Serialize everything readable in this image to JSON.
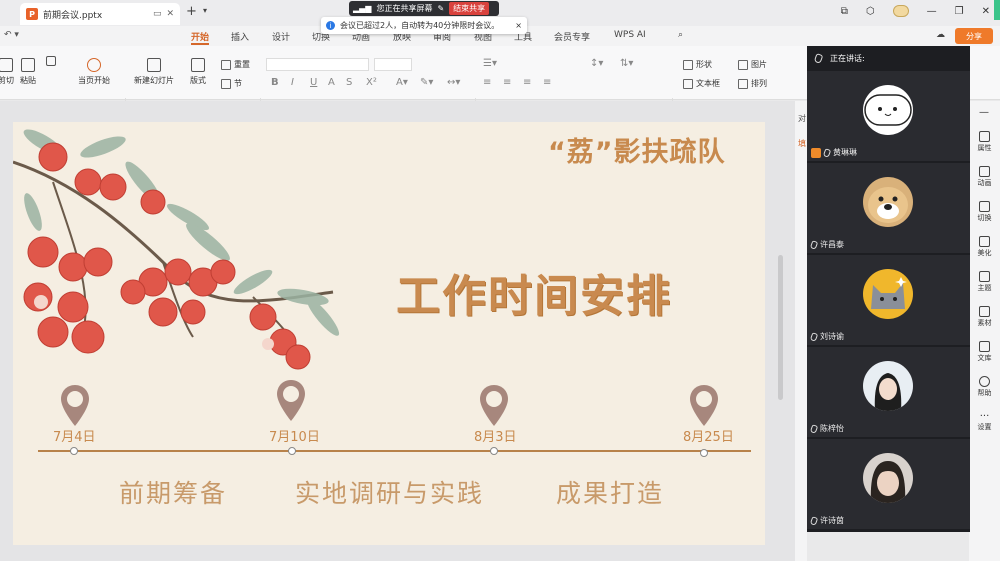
{
  "window": {
    "file_name": "前期会议.pptx",
    "file_icon": "P",
    "new_tab": "+",
    "tab_dropdown": "▾"
  },
  "screen_share": {
    "status": "您正在共享屏幕",
    "end_label": "结束共享",
    "notice": "会议已超过2人，自动转为40分钟限时会议。",
    "close": "×"
  },
  "menu": {
    "items": [
      "开始",
      "插入",
      "设计",
      "切换",
      "动画",
      "放映",
      "审阅",
      "视图",
      "工具",
      "会员专享",
      "WPS AI"
    ],
    "active": "开始",
    "share": "分享"
  },
  "toolbar": {
    "cut": "剪切",
    "paste": "粘贴",
    "play_current": "当页开始",
    "new_slide": "新建幻灯片",
    "layout": "版式",
    "reset": "重置",
    "section": "节",
    "shape": "形状",
    "image": "图片",
    "textbox": "文本框",
    "arrange": "排列"
  },
  "slide": {
    "team_name": "“荔”影扶疏队",
    "title": "工作时间安排",
    "milestones": [
      {
        "date": "7月4日",
        "phase": "前期筹备"
      },
      {
        "date": "7月10日",
        "phase": "实地调研与实践"
      },
      {
        "date": "8月3日",
        "phase": ""
      },
      {
        "date": "8月25日",
        "phase": "成果打造"
      }
    ]
  },
  "panel_side": {
    "tab1": "对",
    "tab2": "填"
  },
  "sidebar": {
    "items": [
      "属性",
      "动画",
      "切换",
      "美化",
      "主题",
      "素材",
      "文库",
      "帮助",
      "设置"
    ]
  },
  "conference": {
    "speaking_label": "正在讲话:",
    "participants": [
      {
        "name": "黄琳琳",
        "host": true
      },
      {
        "name": "许昌泰",
        "host": false
      },
      {
        "name": "刘诗谕",
        "host": false
      },
      {
        "name": "陈梓怡",
        "host": false
      },
      {
        "name": "许诗茵",
        "host": false
      }
    ]
  },
  "colors": {
    "accent": "#d5672a",
    "title": "#c98a4f",
    "slide_bg": "#f5eee2",
    "conf_bg": "#1d1e22"
  }
}
